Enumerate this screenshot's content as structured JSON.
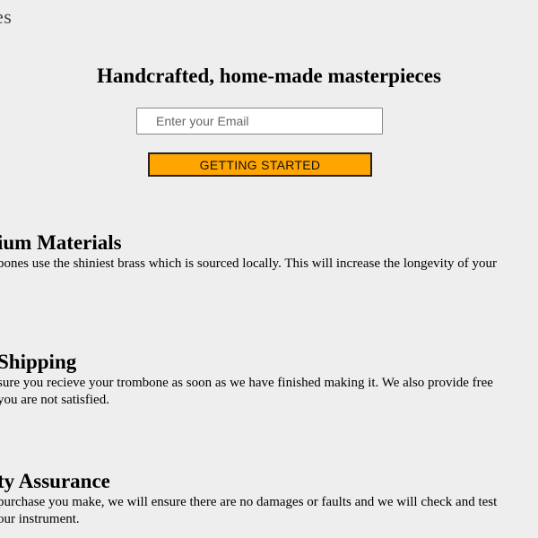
{
  "header": {
    "logo_text": "es"
  },
  "hero": {
    "title": "Handcrafted, home-made masterpieces",
    "email_placeholder": "Enter your Email",
    "cta_label": "GETTING STARTED"
  },
  "features": [
    {
      "title": "ium Materials",
      "desc_line1": "bones use the shiniest brass which is sourced locally. This will increase the longevity of your"
    },
    {
      "title": "Shipping",
      "desc_line1": "sure you recieve your trombone as soon as we have finished making it. We also provide free",
      "desc_line2": "you are not satisfied."
    },
    {
      "title": "ty Assurance",
      "desc_line1": "purchase you make, we will ensure there are no damages or faults and we will check and test",
      "desc_line2": "our instrument."
    }
  ]
}
